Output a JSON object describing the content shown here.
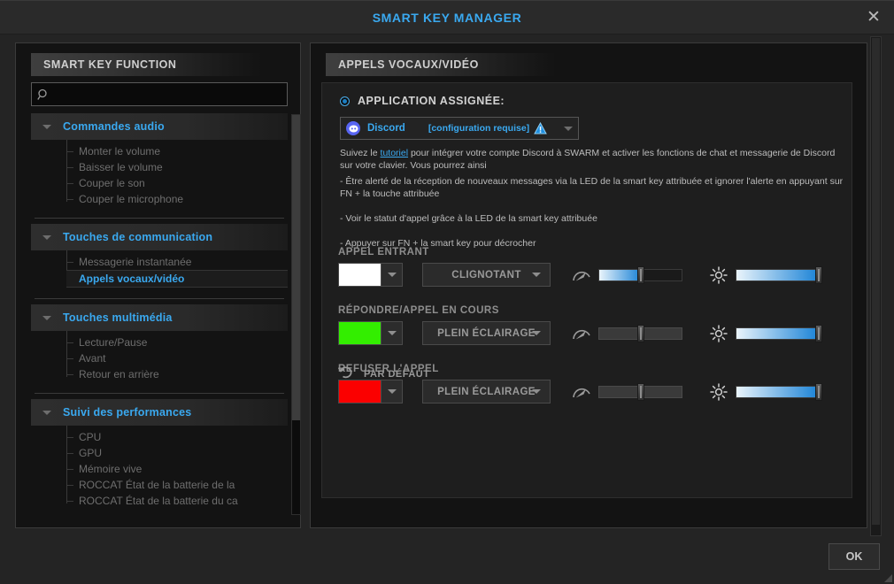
{
  "window": {
    "title": "SMART KEY MANAGER",
    "close_label": "✕",
    "ok_label": "OK"
  },
  "sidebar": {
    "tab_label": "SMART KEY FUNCTION",
    "search_placeholder": "",
    "search_value": "",
    "groups": [
      {
        "label": "Commandes audio",
        "items": [
          {
            "label": "Monter le volume",
            "selected": false
          },
          {
            "label": "Baisser le volume",
            "selected": false
          },
          {
            "label": "Couper le son",
            "selected": false
          },
          {
            "label": "Couper le microphone",
            "selected": false
          }
        ]
      },
      {
        "label": "Touches de communication",
        "items": [
          {
            "label": "Messagerie instantanée",
            "selected": false
          },
          {
            "label": "Appels vocaux/vidéo",
            "selected": true
          }
        ]
      },
      {
        "label": "Touches multimédia",
        "items": [
          {
            "label": "Lecture/Pause",
            "selected": false
          },
          {
            "label": "Avant",
            "selected": false
          },
          {
            "label": "Retour en arrière",
            "selected": false
          }
        ]
      },
      {
        "label": "Suivi des performances",
        "items": [
          {
            "label": "CPU",
            "selected": false
          },
          {
            "label": "GPU",
            "selected": false
          },
          {
            "label": "Mémoire vive",
            "selected": false
          },
          {
            "label": "ROCCAT État de la batterie de la",
            "selected": false
          },
          {
            "label": "ROCCAT État de la batterie du ca",
            "selected": false
          }
        ]
      }
    ]
  },
  "main": {
    "tab_label": "APPELS VOCAUX/VIDÉO",
    "assigned_label": "APPLICATION ASSIGNÉE:",
    "app": {
      "name": "Discord",
      "status": "[configuration requise]",
      "icon": "discord-icon",
      "warning_icon": "warning-triangle-icon"
    },
    "description": {
      "prefix": "Suivez le ",
      "link": "tutoriel",
      "suffix": " pour intégrer votre compte Discord à SWARM et activer les fonctions de chat et messagerie de Discord sur votre clavier. Vous pourrez ainsi"
    },
    "bullets": [
      "- Être alerté de la réception de nouveaux messages via la LED de la smart key attribuée et ignorer l'alerte en appuyant sur FN + la touche attribuée",
      "- Voir le statut d'appel grâce à la LED de la smart key attribuée",
      "- Appuyer sur FN + la smart key pour décrocher"
    ],
    "rows": [
      {
        "label": "APPEL ENTRANT",
        "color": "#ffffff",
        "effect": "CLIGNOTANT",
        "speed": 50,
        "speed_enabled": true,
        "brightness": 100
      },
      {
        "label": "RÉPONDRE/APPEL EN COURS",
        "color": "#33ee00",
        "effect": "PLEIN ÉCLAIRAGE",
        "speed": 50,
        "speed_enabled": false,
        "brightness": 100
      },
      {
        "label": "REFUSER L'APPEL",
        "color": "#fb0000",
        "effect": "PLEIN ÉCLAIRAGE",
        "speed": 50,
        "speed_enabled": false,
        "brightness": 100
      }
    ],
    "reset_label": "PAR DÉFAUT",
    "reset_icon": "undo-arrow-icon"
  },
  "colors": {
    "accent": "#3aa9f0",
    "slider_fill_start": "#eaf4fb",
    "slider_fill_end": "#1a82d6",
    "panel_bg": "#131313",
    "card_bg": "#1e1e1e"
  }
}
